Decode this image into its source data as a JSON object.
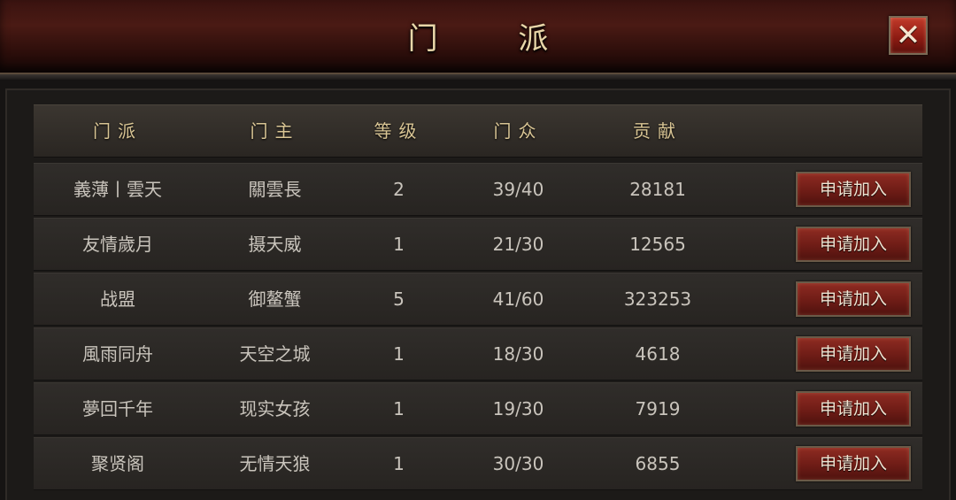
{
  "window": {
    "title": "门 派",
    "close_label": "✕"
  },
  "table": {
    "headers": {
      "name": "门派",
      "leader": "门主",
      "level": "等级",
      "members": "门众",
      "contribution": "贡献"
    },
    "rows": [
      {
        "name": "義薄丨雲天",
        "leader": "關雲長",
        "level": "2",
        "members": "39/40",
        "contribution": "28181",
        "action": "申请加入"
      },
      {
        "name": "友情歲月",
        "leader": "摄天威",
        "level": "1",
        "members": "21/30",
        "contribution": "12565",
        "action": "申请加入"
      },
      {
        "name": "战盟",
        "leader": "御鳌蟹",
        "level": "5",
        "members": "41/60",
        "contribution": "323253",
        "action": "申请加入"
      },
      {
        "name": "風雨同舟",
        "leader": "天空之城",
        "level": "1",
        "members": "18/30",
        "contribution": "4618",
        "action": "申请加入"
      },
      {
        "name": "夢回千年",
        "leader": "现实女孩",
        "level": "1",
        "members": "19/30",
        "contribution": "7919",
        "action": "申请加入"
      },
      {
        "name": "聚贤阁",
        "leader": "无情天狼",
        "level": "1",
        "members": "30/30",
        "contribution": "6855",
        "action": "申请加入"
      }
    ]
  },
  "colors": {
    "title_text": "#e8d6a8",
    "header_text": "#d9c594",
    "cell_text": "#c9c4bc",
    "button_red": "#8e2b22",
    "close_red": "#c23a2a"
  },
  "icons": {
    "close": "close-icon"
  }
}
